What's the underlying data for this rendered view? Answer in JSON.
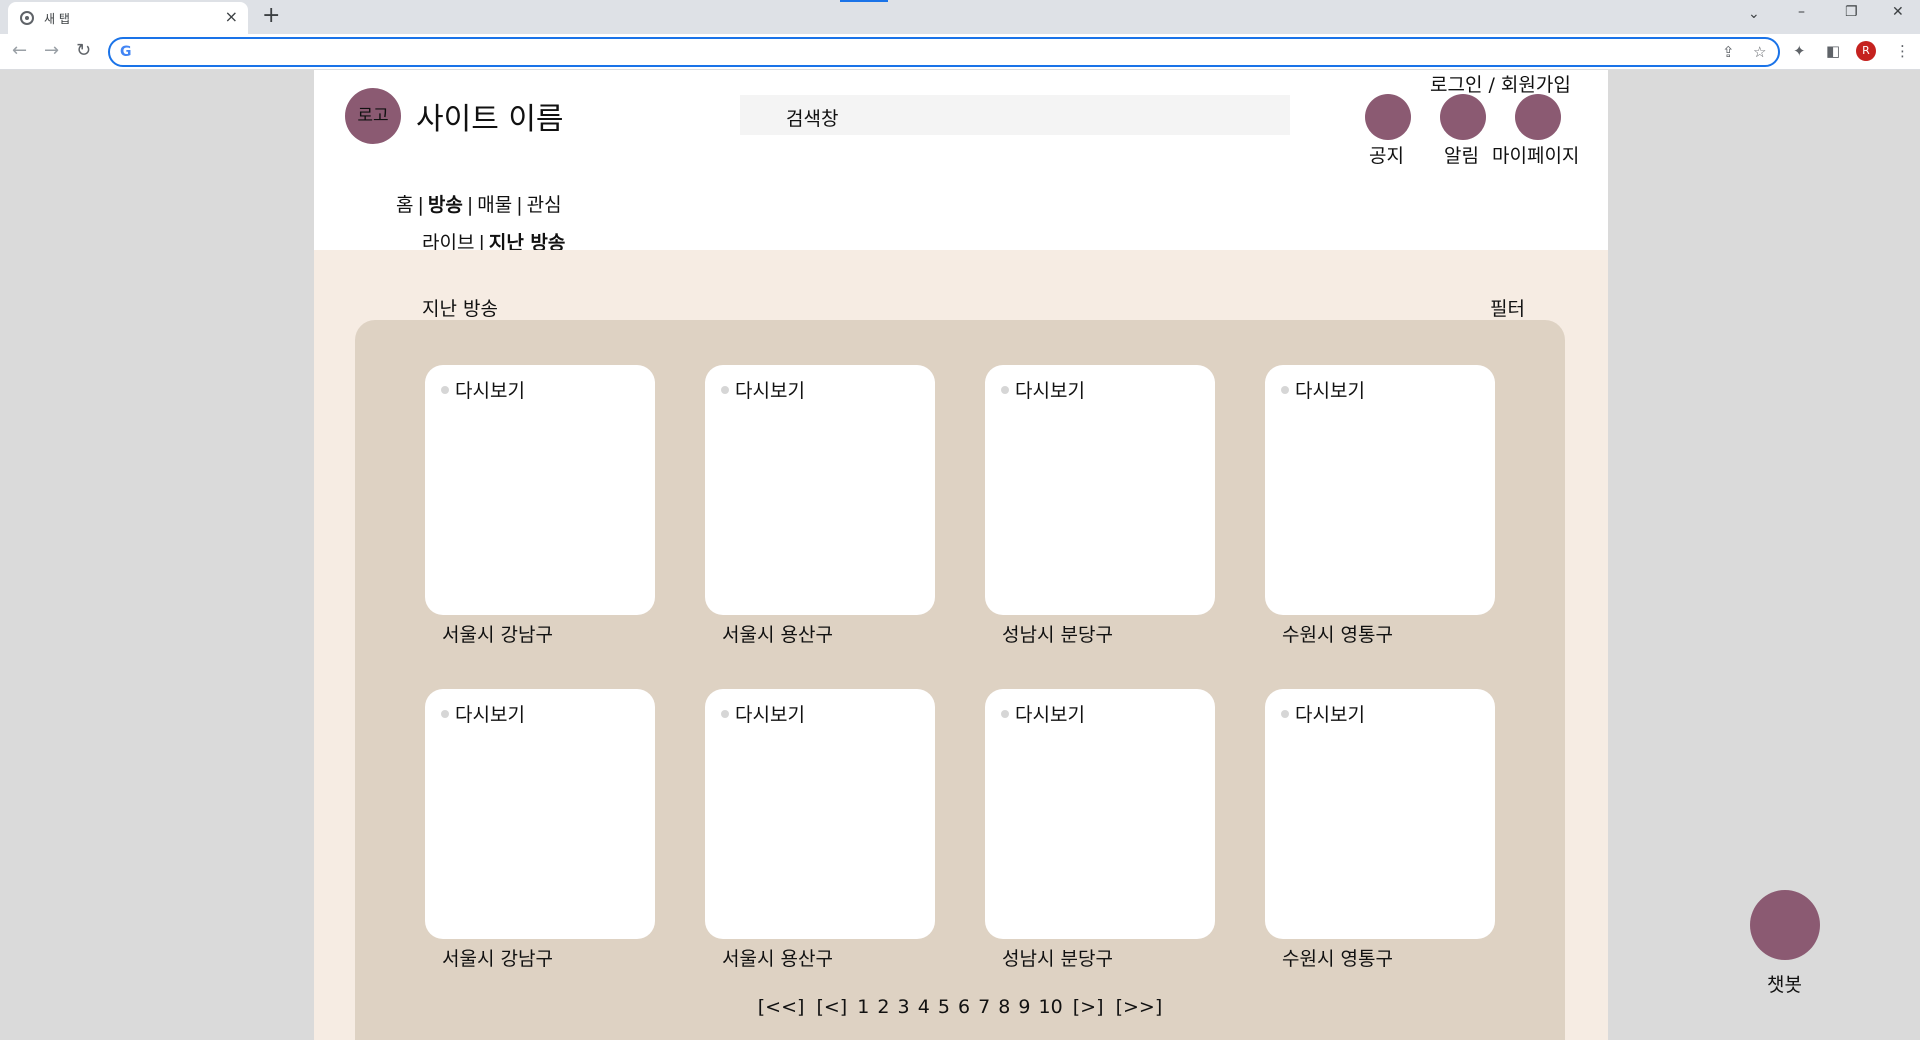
{
  "browser": {
    "tab_title": "새 탭",
    "tab_close": "×",
    "new_tab": "+",
    "tab_search": "⌄",
    "window_controls": [
      "–",
      "❐",
      "✕"
    ],
    "nav": {
      "back": "←",
      "forward": "→",
      "reload": "↻"
    },
    "omnibox": {
      "value": "",
      "g_label": "G"
    },
    "omnibox_icons": [
      "⇪",
      "☆"
    ],
    "extension_icons": [
      "✦",
      "◧"
    ],
    "profile_initial": "R",
    "menu": "⋮"
  },
  "header": {
    "logo_text": "로고",
    "site_name": "사이트 이름",
    "search_text": "검색창",
    "login_link": "로그인 / 회원가입",
    "icons": [
      {
        "label": "공지"
      },
      {
        "label": "알림"
      },
      {
        "label": "마이페이지"
      }
    ]
  },
  "main_nav": {
    "items": [
      "홈",
      "방송",
      "매물",
      "관심"
    ],
    "separator": "|",
    "active": "방송"
  },
  "sub_nav": {
    "items": [
      "라이브",
      "지난 방송"
    ],
    "separator": "|",
    "active": "지난 방송"
  },
  "content": {
    "section_title": "지난 방송",
    "filter_label": "필터",
    "cards": [
      {
        "badge": "다시보기",
        "location": "서울시 강남구"
      },
      {
        "badge": "다시보기",
        "location": "서울시 용산구"
      },
      {
        "badge": "다시보기",
        "location": "성남시 분당구"
      },
      {
        "badge": "다시보기",
        "location": "수원시 영통구"
      },
      {
        "badge": "다시보기",
        "location": "서울시 강남구"
      },
      {
        "badge": "다시보기",
        "location": "서울시 용산구"
      },
      {
        "badge": "다시보기",
        "location": "성남시 분당구"
      },
      {
        "badge": "다시보기",
        "location": "수원시 영통구"
      }
    ]
  },
  "pagination": {
    "first": "[<<]",
    "prev": "[<]",
    "pages": [
      "1",
      "2",
      "3",
      "4",
      "5",
      "6",
      "7",
      "8",
      "9",
      "10"
    ],
    "next": "[>]",
    "last": "[>>]"
  },
  "chatbot": {
    "label": "챗봇"
  },
  "colors": {
    "accent": "#8b5a72",
    "content_bg": "#f6ece3",
    "panel_bg": "#ded2c3",
    "outer_bg": "#dadada"
  }
}
